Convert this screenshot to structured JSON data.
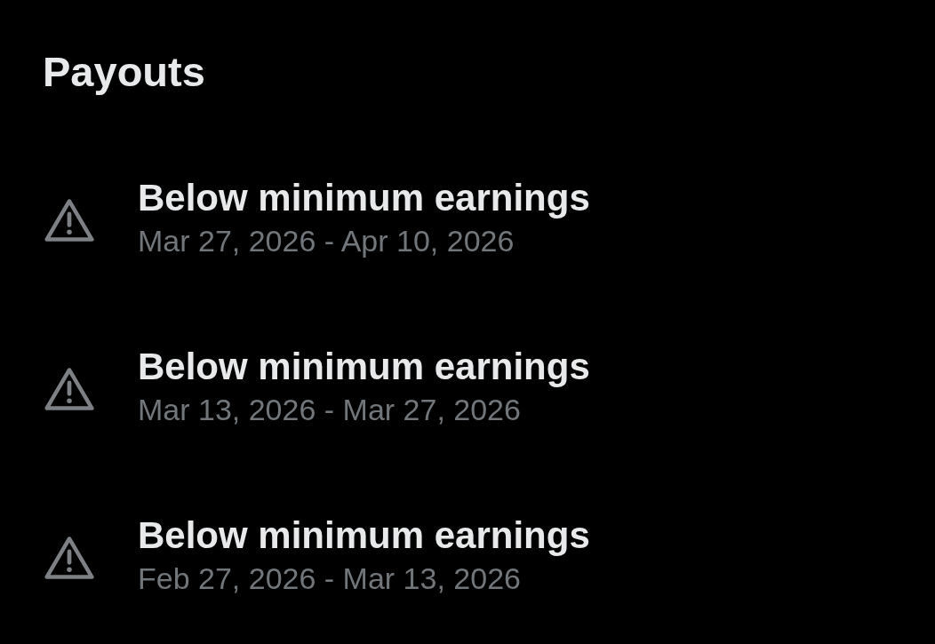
{
  "page": {
    "title": "Payouts"
  },
  "payouts": [
    {
      "status": "Below minimum earnings",
      "period": "Mar 27, 2026 - Apr 10, 2026"
    },
    {
      "status": "Below minimum earnings",
      "period": "Mar 13, 2026 - Mar 27, 2026"
    },
    {
      "status": "Below minimum earnings",
      "period": "Feb 27, 2026 - Mar 13, 2026"
    }
  ]
}
